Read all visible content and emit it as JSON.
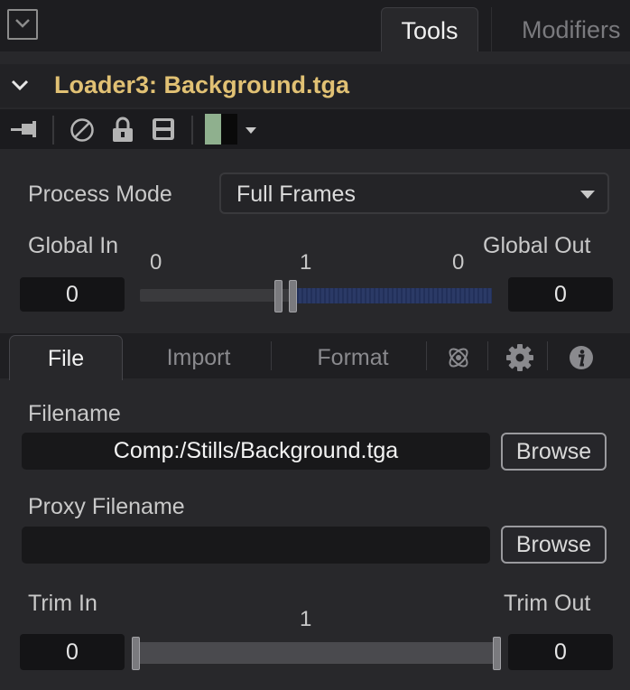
{
  "tabs": {
    "tools": "Tools",
    "modifiers": "Modifiers"
  },
  "tool": {
    "title": "Loader3: Background.tga"
  },
  "toolbar": {
    "icons": [
      "pin-icon",
      "disable-icon",
      "lock-icon",
      "save-icon"
    ],
    "swatch_colors": [
      "#8fb08e",
      "#0a0a0a"
    ]
  },
  "process_mode": {
    "label": "Process Mode",
    "value": "Full Frames"
  },
  "global": {
    "in_label": "Global In",
    "out_label": "Global Out",
    "in_value": "0",
    "out_value": "0",
    "tick_left": "0",
    "tick_mid": "1",
    "tick_right": "0"
  },
  "subtabs": {
    "file": "File",
    "import": "Import",
    "format": "Format"
  },
  "file": {
    "filename_label": "Filename",
    "filename_value": "Comp:/Stills/Background.tga",
    "browse_label": "Browse",
    "proxy_label": "Proxy Filename",
    "proxy_value": "",
    "proxy_browse_label": "Browse"
  },
  "trim": {
    "in_label": "Trim In",
    "out_label": "Trim Out",
    "in_value": "0",
    "out_value": "0",
    "mid_value": "1"
  }
}
